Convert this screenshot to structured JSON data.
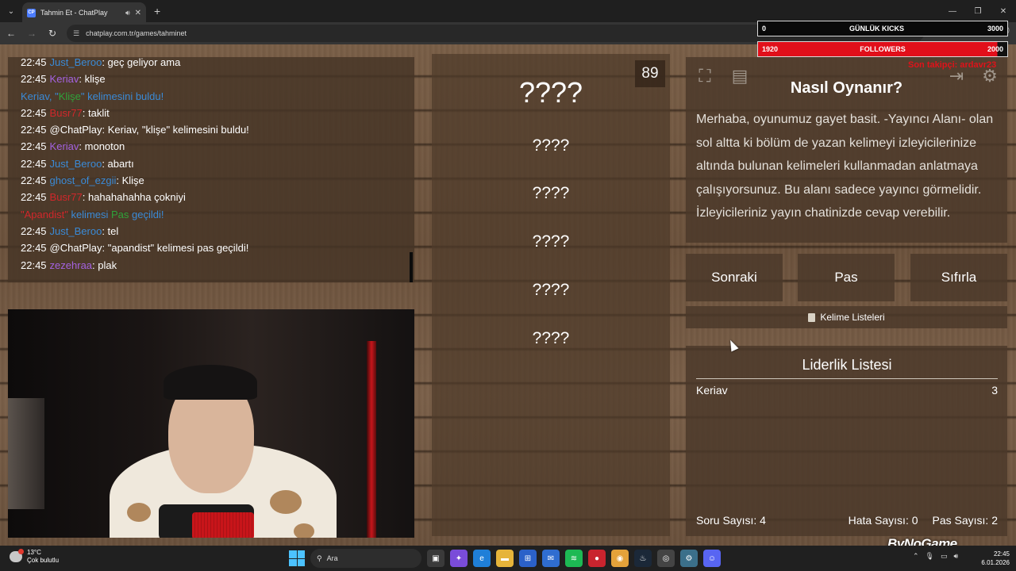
{
  "browser": {
    "tab_title": "Tahmin Et - ChatPlay",
    "tab_favicon": "CP",
    "url": "chatplay.com.tr/games/tahminet"
  },
  "chat": {
    "lines": [
      {
        "time": "22:45",
        "user": "Just_Beroo",
        "user_color": "#3a8ad6",
        "text": ": geç geliyor ama"
      },
      {
        "time": "22:45",
        "user": "Keriav",
        "user_color": "#a462e0",
        "text": ": klişe"
      },
      {
        "time": "",
        "user": "",
        "user_color": "",
        "text": "",
        "system": true,
        "parts": [
          [
            "Keriav, \"",
            "#3a8ad6"
          ],
          [
            "Klişe",
            "#2fa33a"
          ],
          [
            "\" kelimesini buldu!",
            "#3a8ad6"
          ]
        ]
      },
      {
        "time": "22:45",
        "user": "Busr77",
        "user_color": "#d1272b",
        "text": ": taklit"
      },
      {
        "time": "22:45",
        "user": "@ChatPlay",
        "user_color": "#ffffff",
        "text": ": Keriav, \"klişe\" kelimesini buldu!"
      },
      {
        "time": "22:45",
        "user": "Keriav",
        "user_color": "#a462e0",
        "text": ": monoton"
      },
      {
        "time": "22:45",
        "user": "Just_Beroo",
        "user_color": "#3a8ad6",
        "text": ": abartı"
      },
      {
        "time": "22:45",
        "user": "ghost_of_ezgii",
        "user_color": "#3a8ad6",
        "text": ": Klişe"
      },
      {
        "time": "22:45",
        "user": "Busr77",
        "user_color": "#d1272b",
        "text": ": hahahahahha çokniyi"
      },
      {
        "time": "",
        "user": "",
        "user_color": "",
        "text": "",
        "system": true,
        "parts": [
          [
            "\"Apandist\"",
            "#d1272b"
          ],
          [
            " kelimesi ",
            "#3a8ad6"
          ],
          [
            "Pas",
            "#2fa33a"
          ],
          [
            " geçildi!",
            "#3a8ad6"
          ]
        ]
      },
      {
        "time": "22:45",
        "user": "Just_Beroo",
        "user_color": "#3a8ad6",
        "text": ": tel"
      },
      {
        "time": "22:45",
        "user": "@ChatPlay",
        "user_color": "#ffffff",
        "text": ": \"apandist\" kelimesi pas geçildi!"
      },
      {
        "time": "22:45",
        "user": "zezehraa",
        "user_color": "#a462e0",
        "text": ": plak"
      }
    ]
  },
  "game": {
    "counter": "89",
    "main_word": "????",
    "words": [
      "????",
      "????",
      "????",
      "????",
      "????"
    ]
  },
  "help": {
    "title": "Nasıl Oynanır?",
    "text": "Merhaba, oyunumuz gayet basit. -Yayıncı Alanı- olan sol altta ki bölüm de yazan kelimeyi izleyicilerinize altında bulunan kelimeleri kullanmadan anlatmaya çalışıyorsunuz. Bu alanı sadece yayıncı görmelidir. İzleyicileriniz yayın chatinizde cevap verebilir."
  },
  "buttons": {
    "next": "Sonraki",
    "pass": "Pas",
    "reset": "Sıfırla",
    "word_lists": "Kelime Listeleri"
  },
  "leaderboard": {
    "title": "Liderlik Listesi",
    "rows": [
      {
        "name": "Keriav",
        "score": "3"
      }
    ],
    "question_count": "Soru Sayısı: 4",
    "error_count": "Hata Sayısı: 0",
    "pass_count": "Pas Sayısı: 2"
  },
  "overlay": {
    "kicks_left": "0",
    "kicks_label": "GÜNLÜK KICKS",
    "kicks_right": "3000",
    "followers_left": "1920",
    "followers_label": "FOLLOWERS",
    "followers_right": "2000",
    "note": "Son takipçi: ardavr23",
    "brand": "ByNoGame"
  },
  "taskbar": {
    "weather_temp": "13°C",
    "weather_desc": "Çok bulutlu",
    "search_placeholder": "Ara",
    "time": "22:45",
    "date": "6.01.2026"
  }
}
